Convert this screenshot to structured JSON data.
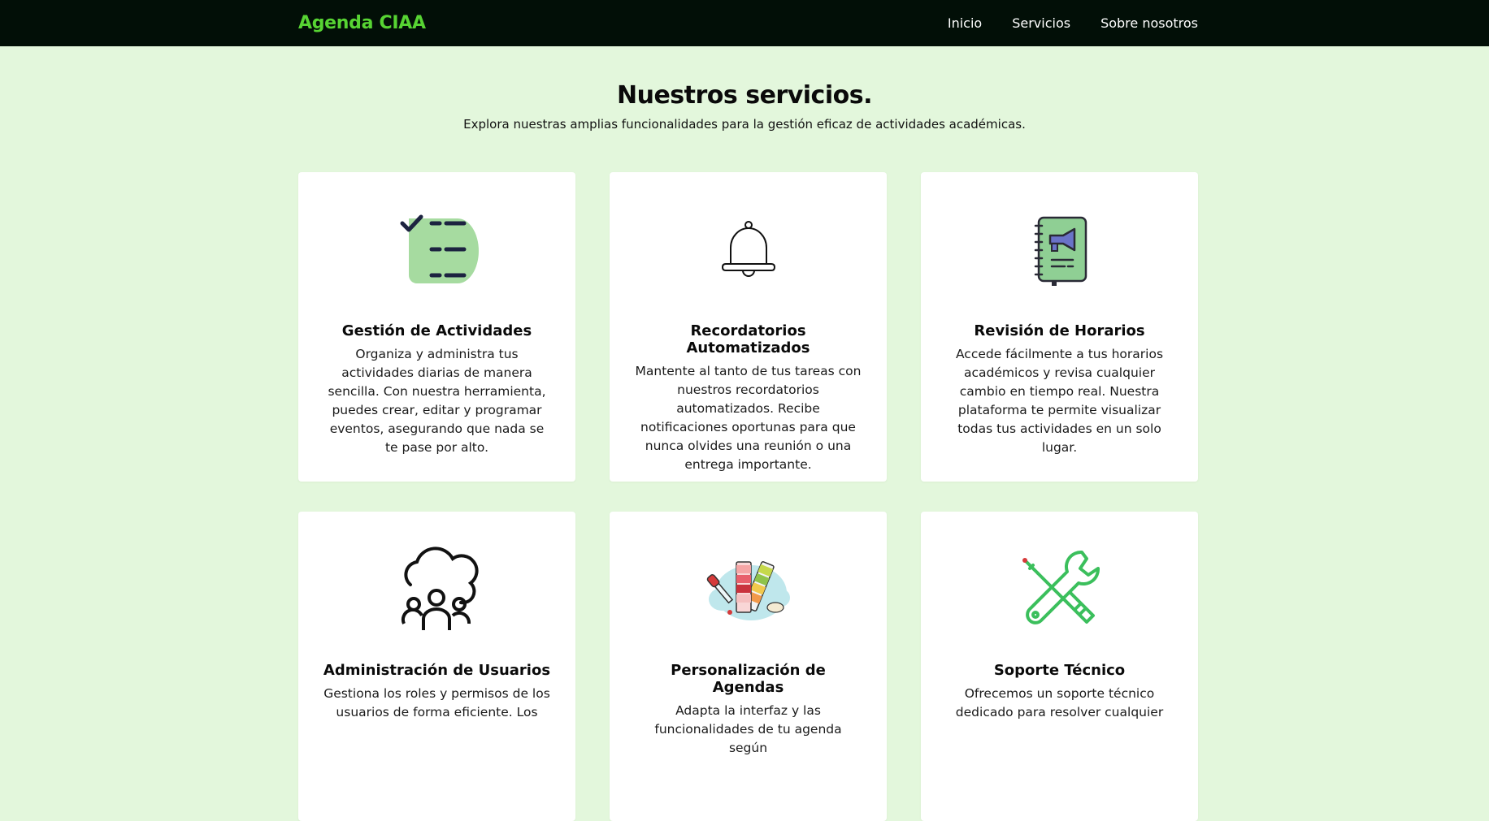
{
  "navbar": {
    "brand": "Agenda CIAA",
    "links": [
      "Inicio",
      "Servicios",
      "Sobre nosotros"
    ]
  },
  "colors": {
    "navbar_bg": "#020f07",
    "brand": "#57d433",
    "page_bg": "#e3f7dc"
  },
  "services": {
    "title": "Nuestros servicios.",
    "subtitle": "Explora nuestras amplias funcionalidades para la gestión eficaz de actividades académicas.",
    "cards": [
      {
        "icon": "checklist-icon",
        "title": "Gestión de Actividades",
        "text": "Organiza y administra tus actividades diarias de manera sencilla. Con nuestra herramienta, puedes crear, editar y programar eventos, asegurando que nada se te pase por alto."
      },
      {
        "icon": "bell-icon",
        "title": "Recordatorios Automatizados",
        "text": "Mantente al tanto de tus tareas con nuestros recordatorios automatizados. Recibe notificaciones oportunas para que nunca olvides una reunión o una entrega importante."
      },
      {
        "icon": "notebook-megaphone-icon",
        "title": "Revisión de Horarios",
        "text": "Accede fácilmente a tus horarios académicos y revisa cualquier cambio en tiempo real. Nuestra plataforma te permite visualizar todas tus actividades en un solo lugar."
      },
      {
        "icon": "cloud-users-icon",
        "title": "Administración de Usuarios",
        "text": "Gestiona los roles y permisos de los usuarios de forma eficiente. Los"
      },
      {
        "icon": "color-palette-icon",
        "title": "Personalización de Agendas",
        "text": "Adapta la interfaz y las funcionalidades de tu agenda según"
      },
      {
        "icon": "tools-icon",
        "title": "Soporte Técnico",
        "text": "Ofrecemos un soporte técnico dedicado para resolver cualquier"
      }
    ]
  }
}
